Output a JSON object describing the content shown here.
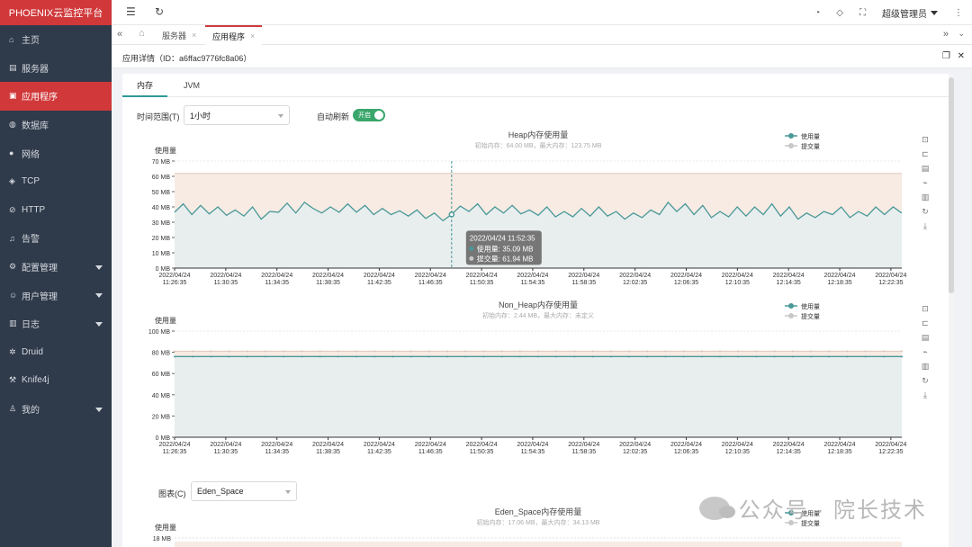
{
  "app": {
    "title": "PHOENIX云监控平台"
  },
  "sidebar": {
    "items": [
      {
        "label": "主页",
        "icon": "home-icon",
        "glyph": "⌂",
        "caret": false,
        "active": false
      },
      {
        "label": "服务器",
        "icon": "server-icon",
        "glyph": "▤",
        "caret": false,
        "active": false
      },
      {
        "label": "应用程序",
        "icon": "application-icon",
        "glyph": "▣",
        "caret": false,
        "active": true
      },
      {
        "label": "数据库",
        "icon": "database-icon",
        "glyph": "◍",
        "caret": false,
        "active": false
      },
      {
        "label": "网络",
        "icon": "globe-icon",
        "glyph": "●",
        "caret": false,
        "active": false
      },
      {
        "label": "TCP",
        "icon": "tcp-icon",
        "glyph": "◈",
        "caret": false,
        "active": false
      },
      {
        "label": "HTTP",
        "icon": "http-icon",
        "glyph": "⊘",
        "caret": false,
        "active": false
      },
      {
        "label": "告警",
        "icon": "bell-icon",
        "glyph": "♫",
        "caret": false,
        "active": false
      },
      {
        "label": "配置管理",
        "icon": "gear-icon",
        "glyph": "⚙",
        "caret": true,
        "active": false
      },
      {
        "label": "用户管理",
        "icon": "user-icon",
        "glyph": "☺",
        "caret": true,
        "active": false
      },
      {
        "label": "日志",
        "icon": "log-icon",
        "glyph": "▥",
        "caret": true,
        "active": false
      },
      {
        "label": "Druid",
        "icon": "druid-icon",
        "glyph": "✲",
        "caret": false,
        "active": false
      },
      {
        "label": "Knife4j",
        "icon": "knife4j-icon",
        "glyph": "⚒",
        "caret": false,
        "active": false
      },
      {
        "label": "我的",
        "icon": "person-icon",
        "glyph": "♙",
        "caret": true,
        "active": false
      }
    ]
  },
  "header": {
    "menu_glyph": "☰",
    "refresh_glyph": "↻",
    "user_label": "超级管理员",
    "more_glyph": "⋮",
    "dashboard_glyph": "◔",
    "tag_glyph": "◇",
    "fullscreen_glyph": "⛶"
  },
  "tabs": {
    "nav_left": "«",
    "home_glyph": "⌂",
    "items": [
      {
        "label": "服务器",
        "close": "×",
        "active": false
      },
      {
        "label": "应用程序",
        "close": "×",
        "active": true
      }
    ],
    "nav_right": "»",
    "dropdown": "⌄"
  },
  "detail": {
    "title": "应用详情（ID：a6ffac9776fc8a06）",
    "restore_glyph": "❐",
    "close_glyph": "✕"
  },
  "content_tabs": [
    {
      "label": "内存",
      "active": true
    },
    {
      "label": "JVM",
      "active": false
    }
  ],
  "filters": {
    "time_range_label": "时间范围(T)",
    "time_range_value": "1小时",
    "auto_refresh_label": "自动刷新",
    "auto_refresh_value": "开启",
    "chart_label": "图表(C)",
    "chart_value": "Eden_Space"
  },
  "toolbox": [
    "⊡",
    "⊏",
    "▤",
    "⌁",
    "▥",
    "↻",
    "⤓"
  ],
  "colors": {
    "used": "#4a9898",
    "committed": "#c8c8c8",
    "committed_fill": "#f7ebe3",
    "used_fill": "#e8eeee",
    "brand": "#d0383a"
  },
  "x_ticks": [
    "2022/04/24 11:26:35",
    "2022/04/24 11:30:35",
    "2022/04/24 11:34:35",
    "2022/04/24 11:38:35",
    "2022/04/24 11:42:35",
    "2022/04/24 11:46:35",
    "2022/04/24 11:50:35",
    "2022/04/24 11:54:35",
    "2022/04/24 11:58:35",
    "2022/04/24 12:02:35",
    "2022/04/24 12:06:35",
    "2022/04/24 12:10:35",
    "2022/04/24 12:14:35",
    "2022/04/24 12:18:35",
    "2022/04/24 12:22:35"
  ],
  "watermark": "公众号 · 院长技术",
  "chart_data": [
    {
      "type": "area",
      "title": "Heap内存使用量",
      "subtitle": "初始内存：64.00 MB，最大内存：123.75 MB",
      "ylabel": "使用量",
      "yticks": [
        "0 MB",
        "10 MB",
        "20 MB",
        "30 MB",
        "40 MB",
        "50 MB",
        "60 MB",
        "70 MB"
      ],
      "ylim": [
        0,
        70
      ],
      "legend": [
        "使用量",
        "提交量"
      ],
      "legend_position": "top-right",
      "series": [
        {
          "name": "使用量",
          "values": [
            36.5,
            42,
            35,
            41,
            35.5,
            40,
            34.5,
            38,
            34,
            40,
            32,
            37,
            36.5,
            42.5,
            36,
            43,
            39,
            36,
            40,
            36.5,
            42,
            36.5,
            41,
            35,
            39,
            35,
            37.5,
            34,
            38,
            32.5,
            36,
            31,
            35.09,
            40.5,
            37,
            42,
            35,
            40,
            36,
            41,
            35.5,
            38,
            34.5,
            40,
            33.5,
            37,
            33.5,
            39,
            34,
            40,
            34,
            37,
            32,
            36,
            33,
            38,
            35,
            43,
            37,
            42,
            35,
            41,
            33,
            37,
            33.5,
            40,
            34,
            40,
            35,
            42,
            34,
            40,
            32,
            36,
            33,
            37,
            35,
            40,
            33,
            37,
            34,
            40,
            35,
            40,
            36
          ]
        },
        {
          "name": "提交量",
          "values": [
            61.94,
            61.94
          ]
        }
      ],
      "tooltip": {
        "time": "2022/04/24 11:52:35",
        "used": "使用量: 35.09 MB",
        "committed": "提交量: 61.94 MB",
        "index": 32
      }
    },
    {
      "type": "area",
      "title": "Non_Heap内存使用量",
      "subtitle": "初始内存：2.44 MB，最大内存：未定义",
      "ylabel": "使用量",
      "yticks": [
        "0 MB",
        "20 MB",
        "40 MB",
        "60 MB",
        "80 MB",
        "100 MB"
      ],
      "ylim": [
        0,
        100
      ],
      "legend": [
        "使用量",
        "提交量"
      ],
      "legend_position": "top-right",
      "series": [
        {
          "name": "使用量",
          "values": [
            76,
            76
          ]
        },
        {
          "name": "提交量",
          "values": [
            81,
            81
          ]
        }
      ]
    },
    {
      "type": "area",
      "title": "Eden_Space内存使用量",
      "subtitle": "初始内存：17.06 MB，最大内存：34.13 MB",
      "ylabel": "使用量",
      "yticks": [
        "18 MB"
      ],
      "ylim": [
        0,
        18
      ],
      "legend": [
        "使用量",
        "提交量"
      ],
      "legend_position": "top-right",
      "series": []
    }
  ]
}
